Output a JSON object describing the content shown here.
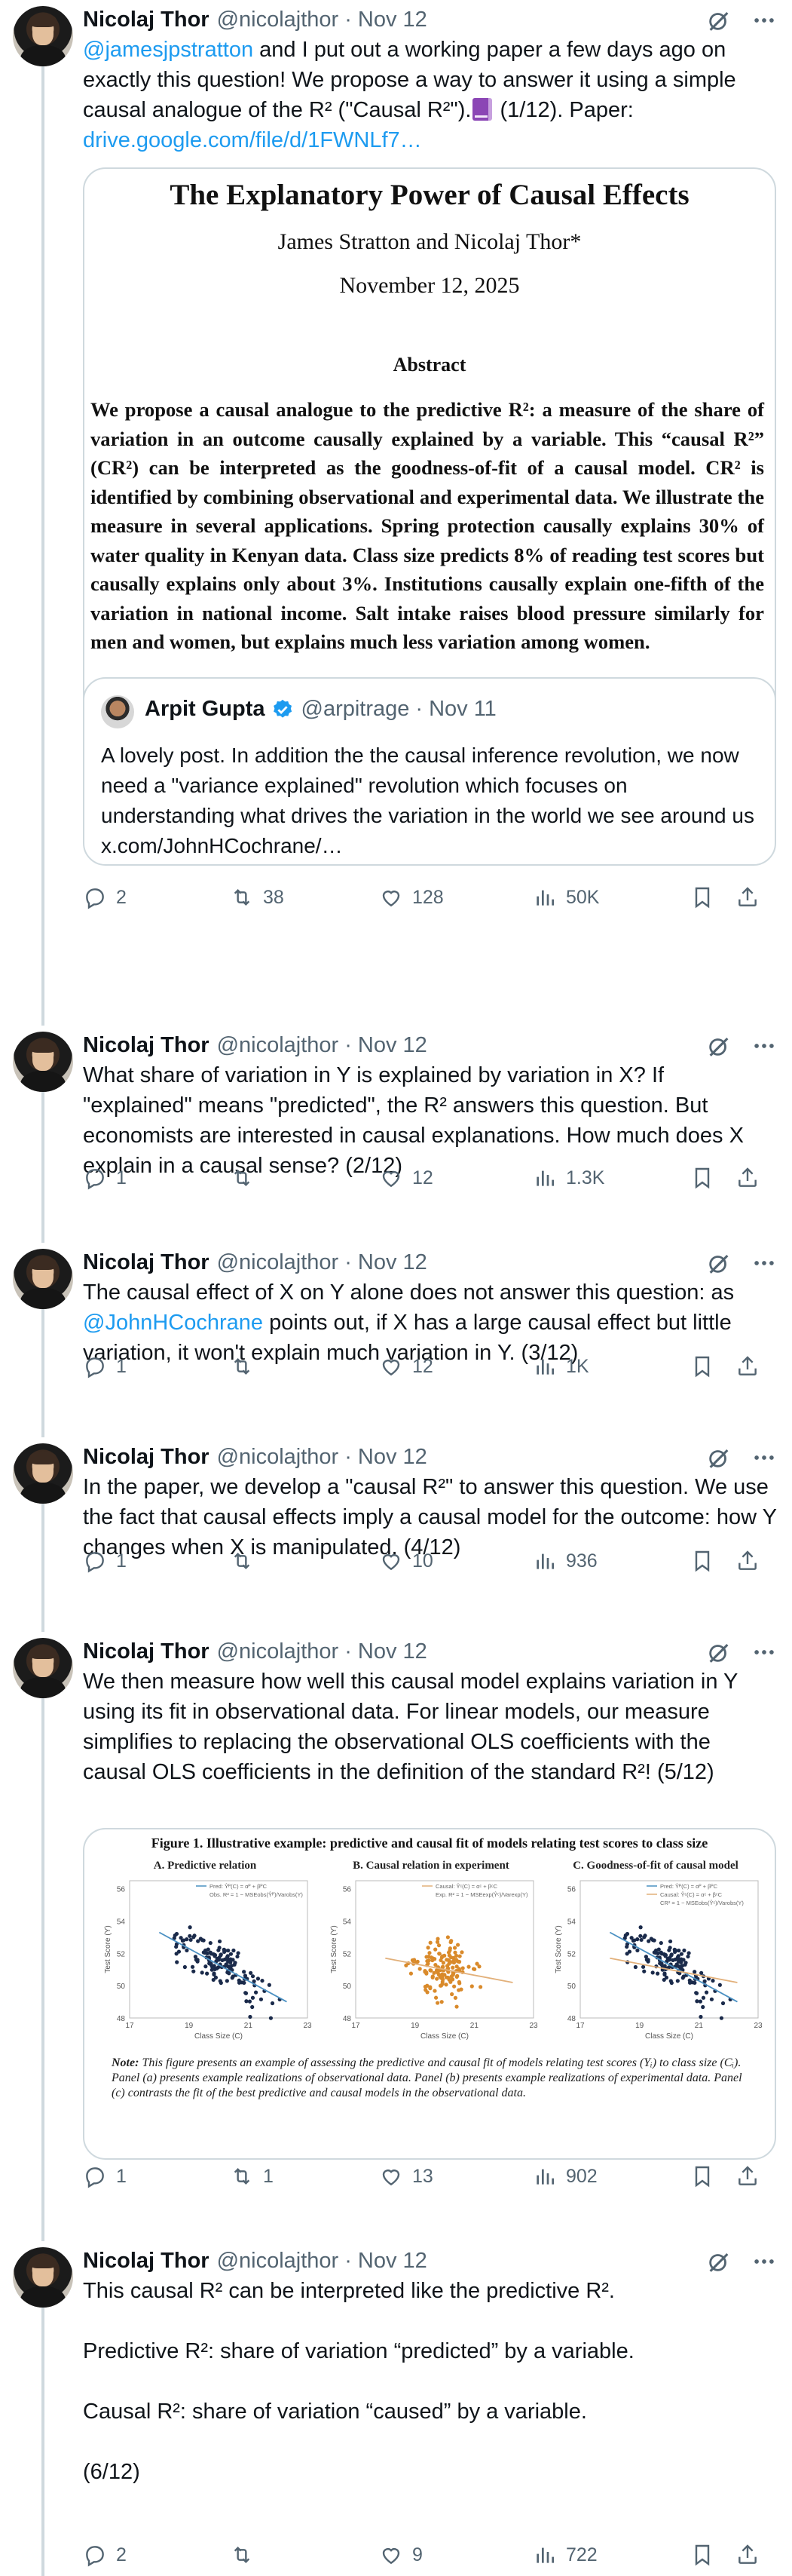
{
  "author": {
    "name": "Nicolaj Thor",
    "handle": "@nicolajthor",
    "date": "Nov 12"
  },
  "separator": "·",
  "tweets": [
    {
      "text_link1": "@jamesjpstratton",
      "text_main": " and I put out a working paper a few days ago on exactly this question! We propose a way to answer it using a simple causal analogue of the R² (\"Causal R²\").",
      "text_after": " (1/12). Paper: ",
      "text_link2": "drive.google.com/file/d/1FWNLf7…",
      "reply": "2",
      "retweet": "38",
      "like": "128",
      "views": "50K"
    },
    {
      "text": "What share of variation in Y is explained by variation in X? If \"explained\" means \"predicted\", the R² answers this question. But economists are interested in causal explanations. How much does X explain in a causal sense? (2/12)",
      "reply": "1",
      "retweet": "",
      "like": "12",
      "views": "1.3K"
    },
    {
      "text_before": "The causal effect of X on Y alone does not answer this question: as ",
      "text_link": "@JohnHCochrane",
      "text_after": " points out, if X has a large causal effect but little variation, it won't explain much variation in Y. (3/12)",
      "reply": "1",
      "retweet": "",
      "like": "12",
      "views": "1K"
    },
    {
      "text": "In the paper, we develop a \"causal R²\" to answer this question. We use the fact that causal effects imply a causal model for the outcome: how Y changes when X is manipulated. (4/12)",
      "reply": "1",
      "retweet": "",
      "like": "10",
      "views": "936"
    },
    {
      "text": "We then measure how well this causal model explains variation in Y using its fit in observational data. For linear models, our measure simplifies to replacing the observational OLS coefficients with the causal OLS coefficients in the definition of the standard R²! (5/12)",
      "reply": "1",
      "retweet": "1",
      "like": "13",
      "views": "902"
    },
    {
      "p1": "This causal R² can be interpreted like the predictive R².",
      "p2": "Predictive R²: share of variation “predicted” by a variable.",
      "p3": "Causal R²: share of variation “caused” by a variable.",
      "p4": "(6/12)",
      "reply": "2",
      "retweet": "",
      "like": "9",
      "views": "722"
    }
  ],
  "paper": {
    "title": "The Explanatory Power of Causal Effects",
    "authors": "James Stratton and Nicolaj Thor*",
    "date": "November 12, 2025",
    "abstract_heading": "Abstract",
    "abstract": "We propose a causal analogue to the predictive R²: a measure of the share of variation in an outcome causally explained by a variable. This “causal R²” (CR²) can be interpreted as the goodness-of-fit of a causal model. CR² is identified by combining observational and experimental data. We illustrate the measure in several applications. Spring protection causally explains 30% of water quality in Kenyan data. Class size predicts 8% of reading test scores but causally explains only about 3%. Institutions causally explain one-fifth of the variation in national income. Salt intake raises blood pressure similarly for men and women, but explains much less variation among women."
  },
  "quote": {
    "name": "Arpit Gupta",
    "handle": "@arpitrage",
    "date": "Nov 11",
    "text": "A lovely post. In addition the the causal inference revolution, we now need a \"variance explained\" revolution which focuses on understanding what drives the variation in the world we see around us x.com/JohnHCochrane/…"
  },
  "figure": {
    "title": "Figure 1. Illustrative example: predictive and causal fit of models relating test scores to class size",
    "panels": [
      {
        "title": "A. Predictive relation",
        "legend1": "Pred: Ŷᴾ(C) = αᴾ + βᴾC",
        "legend2": "Obs. R² = 1 − MSEobs(Ŷᴾ)/Varobs(Y)"
      },
      {
        "title": "B. Causal relation in experiment",
        "legend1": "Causal: Ŷᶜ(C) = αᶜ + βᶜC",
        "legend2": "Exp. R² = 1 − MSEexp(Ŷᶜ)/Varexp(Y)"
      },
      {
        "title": "C. Goodness-of-fit of causal model",
        "legend1": "Pred: Ŷᴾ(C) = αᴾ + βᴾC",
        "legend2": "Causal: Ŷᶜ(C) = αᶜ + βᶜC",
        "legend3": "CR² = 1 − MSEobs(Ŷᶜ)/Varobs(Y)"
      }
    ],
    "ylabel": "Test Score (Y)",
    "xlabel": "Class Size (C)",
    "yticks": [
      "56",
      "54",
      "52",
      "50",
      "48"
    ],
    "xticks": [
      "17",
      "19",
      "21",
      "23"
    ],
    "note_label": "Note:",
    "note": " This figure presents an example of assessing the predictive and causal fit of models relating test scores (Yᵢ) to class size (Cᵢ). Panel (a) presents example realizations of observational data. Panel (b) presents example realizations of experimental data. Panel (c) contrasts the fit of the best predictive and causal models in the observational data.",
    "colors": {
      "observational": "#1a2a4a",
      "experimental": "#d98a2b",
      "pred_line": "#4a90c2",
      "causal_line": "#e2b07a"
    }
  },
  "icons": {
    "reply": "reply-icon",
    "retweet": "retweet-icon",
    "like": "like-icon",
    "views": "views-icon",
    "bookmark": "bookmark-icon",
    "share": "share-icon",
    "grok": "grok-icon",
    "more": "more-icon",
    "verified": "verified-badge-icon"
  }
}
